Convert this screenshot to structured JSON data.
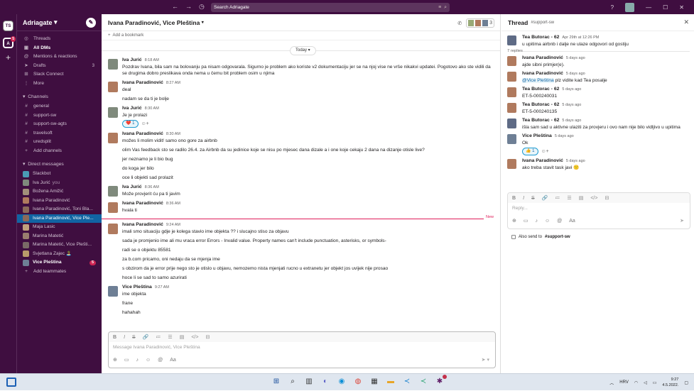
{
  "topbar": {
    "search": "Search Adriagate"
  },
  "rail": {
    "workspaces": [
      {
        "abbr": "TS"
      },
      {
        "abbr": "A",
        "badge": "5"
      }
    ]
  },
  "sidebar": {
    "workspace_name": "Adriagate",
    "nav": [
      {
        "icon": "threads-icon",
        "glyph": "◎",
        "label": "Threads"
      },
      {
        "icon": "dm-icon",
        "glyph": "▣",
        "label": "All DMs",
        "bold": true
      },
      {
        "icon": "at-icon",
        "glyph": "@",
        "label": "Mentions & reactions"
      },
      {
        "icon": "drafts-icon",
        "glyph": "➤",
        "label": "Drafts",
        "count": "3"
      },
      {
        "icon": "connect-icon",
        "glyph": "⊞",
        "label": "Slack Connect"
      },
      {
        "icon": "more-icon",
        "glyph": "⋮",
        "label": "More"
      }
    ],
    "channels_header": "Channels",
    "channels": [
      "general",
      "support-sw",
      "support-sw-agts",
      "travelsoft",
      "uredsplit"
    ],
    "add_channels": "Add channels",
    "dm_header": "Direct messages",
    "dms": [
      {
        "label": "Slackbot",
        "color": "#4a9ab5"
      },
      {
        "label": "Iva Jurić",
        "you": "you",
        "color": "#7f8a7c"
      },
      {
        "label": "Božena Amižić",
        "color": "#a28f7a"
      },
      {
        "label": "Ivana Paradinović",
        "color": "#b07a5e"
      },
      {
        "label": "Ivana Paradinović, Toni Bla...",
        "color": "#8b6a5a"
      },
      {
        "label": "Ivana Paradinović, Vice Ple...",
        "selected": true,
        "color": "#8b6a5a"
      },
      {
        "label": "Maja Lasic",
        "color": "#c1a17c"
      },
      {
        "label": "Marina Matetić",
        "color": "#9a7d6e"
      },
      {
        "label": "Marina Matetić, Vice Plešti...",
        "color": "#7a6a66"
      },
      {
        "label": "Svjetlana Zajec 🏝️",
        "color": "#b99a6a"
      },
      {
        "label": "Vice Pleština",
        "bold": true,
        "pill": "5",
        "color": "#6e7f95"
      }
    ],
    "add_teammates": "Add teammates"
  },
  "main": {
    "title": "Ivana Paradinović, Vice Pleština",
    "member_count": "3",
    "bookmark": "Add a bookmark",
    "day": "Today",
    "new_label": "New",
    "messages": [
      {
        "author": "Iva Jurić",
        "time": "8:18 AM",
        "av": "iva",
        "lines": [
          "Pozdrav Ivana, bila sam na bolovanju pa nisam odgovarala. Sigurno je problem ako koriste v2 dokumentaciju jer se na njoj vise ne vrše nikakvi updatei. Pogotovo ako ste vidili da se drugima dobro preslikava onda nema u čemu bit problem osim u njima"
        ]
      },
      {
        "author": "Ivana Paradinović",
        "time": "8:27 AM",
        "av": "ivana",
        "lines": [
          "deal",
          "nadam se da ti je bolje"
        ]
      },
      {
        "author": "Iva Jurić",
        "time": "8:30 AM",
        "av": "iva",
        "lines": [
          "Je je prolazi"
        ],
        "reaction": {
          "emoji": "❤️",
          "count": "1"
        }
      },
      {
        "author": "Ivana Paradinović",
        "time": "8:30 AM",
        "av": "ivana",
        "lines": [
          "možes li molim vidit! samo ono gore za airbnb",
          "olim Vas feedback sto se radilo 26.4. za Airbnb da su jedinice koje se nisu po mjesec dana dizale a i one koje cekaju 2 dana na dizanje otisle live?",
          "jer neznamo je li bio bug",
          "do koga jer bilo",
          "oce li objekti sad prolazit"
        ]
      },
      {
        "author": "Iva Jurić",
        "time": "8:36 AM",
        "av": "iva",
        "lines": [
          "Može provjerit ću pa ti javim"
        ]
      },
      {
        "author": "Ivana Paradinović",
        "time": "8:36 AM",
        "av": "ivana",
        "lines": [
          "hvala ti"
        ]
      },
      {
        "author": "Ivana Paradinović",
        "time": "9:24 AM",
        "av": "ivana",
        "newline": true,
        "lines": [
          "imali smo situaciju gdje je kolega stavio ime objekta ?? i slucajno stiso za objavu",
          "sada je promjenio ime ali mu vraca error Errors - Invalid value. Property names can't include punctuation, asterisks, or symbols-",
          "radi se o objektu 85581",
          "za b.com pricamo, oni nedaju da se mjenja ime",
          "s obzirom da je error prije nego sto je otislo u objavu, nemozemo nista mjenjati rucno u extranetu jer objekt jos uvijek nije prosao",
          "hoce li se sad to samo azurirati"
        ]
      },
      {
        "author": "Vice Pleština",
        "time": "9:27 AM",
        "av": "vice",
        "lines": [
          "ime objekta",
          "frane",
          "hahahah"
        ]
      }
    ],
    "composer_placeholder": "Message Ivana Paradinović, Vice Pleština"
  },
  "thread": {
    "title": "Thread",
    "channel": "#support-sw",
    "parent": {
      "author": "Tea Butorac - 62",
      "time": "Apr 29th at 12:26 PM",
      "text": "u upitima airbnb i dalje ne ulaze odgovori od gostiju"
    },
    "replies_count": "7 replies",
    "replies": [
      {
        "author": "Ivana Paradinović",
        "time": "5 days ago",
        "av": "ivana",
        "text": "ajde sibni primjer(e)."
      },
      {
        "author": "Ivana Paradinović",
        "time": "5 days ago",
        "av": "ivana",
        "mention": "@Vice Pleština",
        "text": " plz vidite kad Tea posalje"
      },
      {
        "author": "Tea Butorac - 62",
        "time": "5 days ago",
        "av": "ivana",
        "text": "ET-5-000240031"
      },
      {
        "author": "Tea Butorac - 62",
        "time": "5 days ago",
        "av": "ivana",
        "text": "ET-5-000240135"
      },
      {
        "author": "Tea Butorac - 62",
        "time": "5 days ago",
        "av": "tea",
        "text": "išla sam sad u aktivne ulaziti za provjeru i ovo nam nije bilo vidljivo u upitima"
      },
      {
        "author": "Vice Pleština",
        "time": "5 days ago",
        "av": "vice",
        "text": "Ok",
        "reaction": {
          "emoji": "👍",
          "count": "1"
        }
      },
      {
        "author": "Ivana Paradinović",
        "time": "5 days ago",
        "av": "ivana",
        "text": "ako treba stavit task javi 🙁"
      }
    ],
    "reply_placeholder": "Reply...",
    "also_send": "Also send to",
    "also_send_channel": "#support-sw"
  },
  "taskbar": {
    "lang": "HRV",
    "time": "9:27",
    "date": "4.5.2022."
  }
}
